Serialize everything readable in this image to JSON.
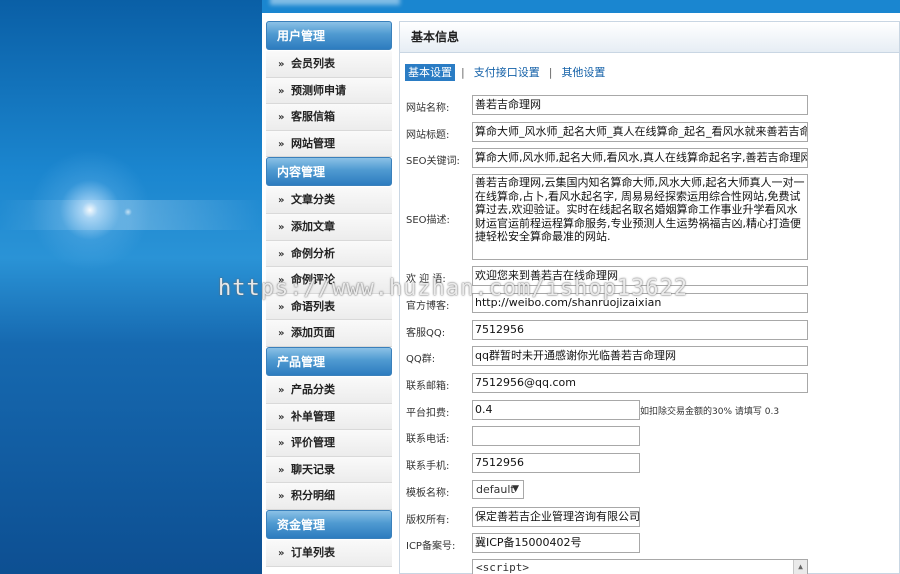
{
  "sidebar": {
    "sections": [
      {
        "title": "用户管理",
        "items": [
          "会员列表",
          "预测师申请",
          "客服信箱",
          "网站管理"
        ]
      },
      {
        "title": "内容管理",
        "items": [
          "文章分类",
          "添加文章",
          "命例分析",
          "命例评论",
          "命语列表",
          "添加页面"
        ]
      },
      {
        "title": "产品管理",
        "items": [
          "产品分类",
          "补单管理",
          "评价管理",
          "聊天记录",
          "积分明细"
        ]
      },
      {
        "title": "资金管理",
        "items": [
          "订单列表"
        ]
      }
    ]
  },
  "panel": {
    "title": "基本信息"
  },
  "tabs": [
    "基本设置",
    "支付接口设置",
    "其他设置"
  ],
  "tab_separator": "|",
  "form": {
    "site_name": {
      "label": "网站名称:",
      "value": "善若吉命理网"
    },
    "site_title": {
      "label": "网站标题:",
      "value": "算命大师_风水师_起名大师_真人在线算命_起名_看风水就来善若吉命"
    },
    "seo_keywords": {
      "label": "SEO关键词:",
      "value": "算命大师,风水师,起名大师,看风水,真人在线算命起名字,善若吉命理网,"
    },
    "seo_desc": {
      "label": "SEO描述:",
      "value": "善若吉命理网,云集国内知名算命大师,风水大师,起名大师真人一对一在线算命,占卜,看风水起名字, 周易易经探索运用综合性网站,免费试算过去,欢迎验证。实时在线起名取名婚姻算命工作事业升学看风水财运官运前程运程算命服务,专业预测人生运势祸福吉凶,精心打造便捷轻松安全算命最准的网站."
    },
    "welcome": {
      "label": "欢 迎 语:",
      "value": "欢迎您来到善若吉在线命理网"
    },
    "weibo": {
      "label": "官方博客:",
      "value": "http://weibo.com/shanruojizaixian"
    },
    "service_qq": {
      "label": "客服QQ:",
      "value": "7512956"
    },
    "qq_group": {
      "label": "QQ群:",
      "value": "qq群暂时未开通感谢你光临善若吉命理网"
    },
    "email": {
      "label": "联系邮箱:",
      "value": "7512956@qq.com"
    },
    "fee": {
      "label": "平台扣费:",
      "value": "0.4",
      "hint": "如扣除交易金额的30% 请填写 0.3"
    },
    "phone": {
      "label": "联系电话:",
      "value": ""
    },
    "mobile": {
      "label": "联系手机:",
      "value": "7512956"
    },
    "template": {
      "label": "模板名称:",
      "value": "default"
    },
    "copyright": {
      "label": "版权所有:",
      "value": "保定善若吉企业管理咨询有限公司"
    },
    "icp": {
      "label": "ICP备案号:",
      "value": "冀ICP备15000402号"
    },
    "script": {
      "value": "<script>"
    }
  },
  "watermark": "https://www.huzhan.com/ishop13622",
  "colors": {
    "accent": "#2a7cc4",
    "header_bg": "#4f9ad1"
  }
}
